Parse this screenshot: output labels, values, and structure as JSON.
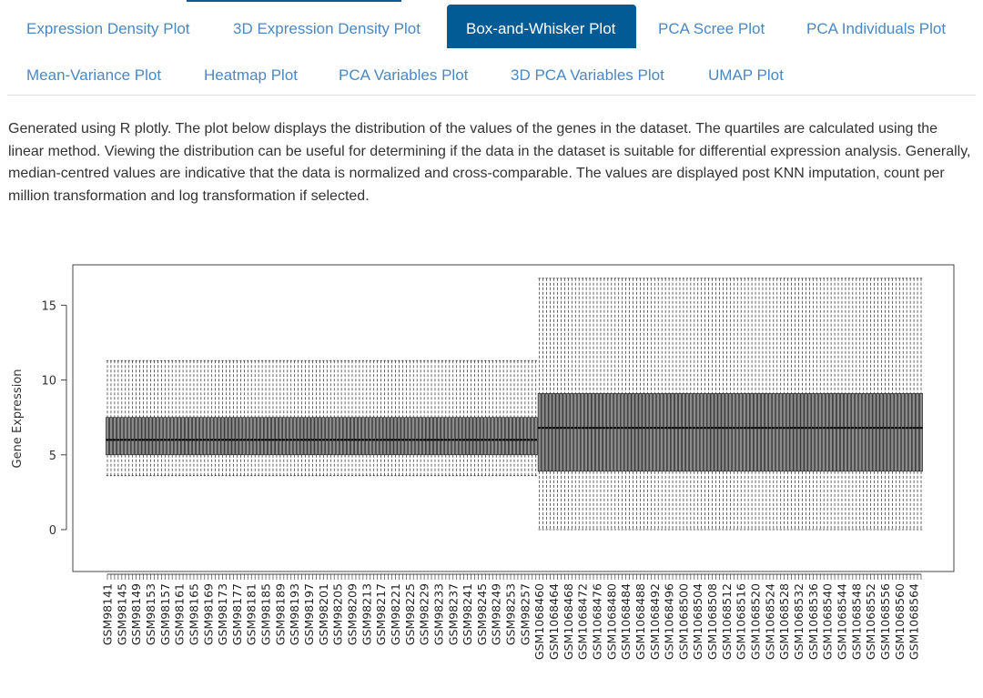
{
  "tabs": [
    {
      "label": "Expression Density Plot",
      "active": false
    },
    {
      "label": "3D Expression Density Plot",
      "active": false
    },
    {
      "label": "Box-and-Whisker Plot",
      "active": true
    },
    {
      "label": "PCA Scree Plot",
      "active": false
    },
    {
      "label": "PCA Individuals Plot",
      "active": false
    },
    {
      "label": "Mean-Variance Plot",
      "active": false
    },
    {
      "label": "Heatmap Plot",
      "active": false
    },
    {
      "label": "PCA Variables Plot",
      "active": false
    },
    {
      "label": "3D PCA Variables Plot",
      "active": false
    },
    {
      "label": "UMAP Plot",
      "active": false
    }
  ],
  "colors": {
    "active_tab": "#035b96",
    "tab_text": "#4a88c4",
    "box_fill": "#8c8c8c"
  },
  "description": "Generated using R plotly. The plot below displays the distribution of the values of the genes in the dataset. The quartiles are calculated using the linear method. Viewing the distribution can be useful for determining if the data in the dataset is suitable for differential expression analysis. Generally, median-centred values are indicative that the data is normalized and cross-comparable. The values are displayed post KNN imputation, count per million transformation and log transformation if selected.",
  "chart_data": {
    "type": "box",
    "title": "",
    "xlabel": "",
    "ylabel": "Gene Expression",
    "ylim": [
      -2.8,
      17.7
    ],
    "yticks": [
      0,
      5,
      10,
      15
    ],
    "grid": false,
    "x_tick_label_every": 4,
    "groups": [
      {
        "sample_prefix": "GSM",
        "first_id": 98141,
        "last_id": 98260,
        "whisker_low": 3.6,
        "q1": 5.0,
        "median": 6.0,
        "q3": 7.5,
        "whisker_high": 11.3
      },
      {
        "sample_prefix": "GSM",
        "first_id": 1068460,
        "last_id": 1068566,
        "whisker_low": 0.0,
        "q1": 3.9,
        "median": 6.8,
        "q3": 9.1,
        "whisker_high": 16.8
      }
    ],
    "tick_labels": [
      "GSM98141",
      "GSM98145",
      "GSM98149",
      "GSM98153",
      "GSM98157",
      "GSM98161",
      "GSM98165",
      "GSM98169",
      "GSM98173",
      "GSM98177",
      "GSM98181",
      "GSM98185",
      "GSM98189",
      "GSM98193",
      "GSM98197",
      "GSM98201",
      "GSM98205",
      "GSM98209",
      "GSM98213",
      "GSM98217",
      "GSM98221",
      "GSM98225",
      "GSM98229",
      "GSM98233",
      "GSM98237",
      "GSM98241",
      "GSM98245",
      "GSM98249",
      "GSM98253",
      "GSM98257",
      "GSM1068460",
      "GSM1068464",
      "GSM1068468",
      "GSM1068472",
      "GSM1068476",
      "GSM1068480",
      "GSM1068484",
      "GSM1068488",
      "GSM1068492",
      "GSM1068496",
      "GSM1068500",
      "GSM1068504",
      "GSM1068508",
      "GSM1068512",
      "GSM1068516",
      "GSM1068520",
      "GSM1068524",
      "GSM1068528",
      "GSM1068532",
      "GSM1068536",
      "GSM1068540",
      "GSM1068544",
      "GSM1068548",
      "GSM1068552",
      "GSM1068556",
      "GSM1068560",
      "GSM1068564"
    ]
  }
}
